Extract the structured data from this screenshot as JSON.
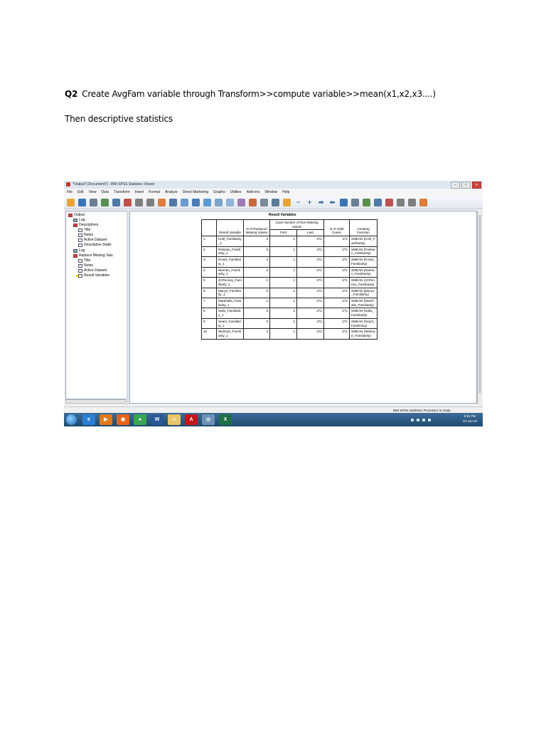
{
  "document": {
    "question_number": "Q2",
    "question_text": "Create AvgFam variable through Transform>>compute variable>>mean(x1,x2,x3....)",
    "subtext": "Then descriptive statistics"
  },
  "window": {
    "title": "*Output7 [Document7] - IBM SPSS Statistics Viewer",
    "controls": {
      "minimize": "–",
      "maximize": "□",
      "close": "✕"
    }
  },
  "menubar": {
    "items": [
      "File",
      "Edit",
      "View",
      "Data",
      "Transform",
      "Insert",
      "Format",
      "Analyze",
      "Direct Marketing",
      "Graphs",
      "Utilities",
      "Add-ons",
      "Window",
      "Help"
    ]
  },
  "toolbar": {
    "icons": [
      "open-icon",
      "save-icon",
      "print-icon",
      "print-preview-icon",
      "export-icon",
      "recall-dialog-icon",
      "undo-icon",
      "redo-icon",
      "goto-case-icon",
      "goto-variable-icon",
      "variables-icon",
      "insert-cases-icon",
      "insert-variable-icon",
      "split-file-icon",
      "select-cases-icon",
      "weight-cases-icon",
      "value-labels-icon",
      "show-all-icon",
      "designate-window-icon",
      "promote-icon",
      "demote-icon",
      "expand-icon",
      "collapse-icon",
      "show-icon",
      "hide-icon",
      "insert-heading-icon",
      "insert-title-icon",
      "insert-text-icon"
    ],
    "prev_symbol": "⬅",
    "next_symbol": "➡",
    "expand_symbol": "+",
    "collapse_symbol": "−"
  },
  "navigator": {
    "items": [
      {
        "label": "Output",
        "icon": "output-book-icon"
      },
      {
        "label": "Log",
        "icon": "log-icon"
      },
      {
        "label": "Descriptives",
        "icon": "descriptives-book-icon"
      },
      {
        "label": "Title",
        "icon": "title-icon"
      },
      {
        "label": "Notes",
        "icon": "notes-icon"
      },
      {
        "label": "Active Dataset",
        "icon": "active-dataset-icon"
      },
      {
        "label": "Descriptive Statis",
        "icon": "descriptive-stats-icon"
      },
      {
        "label": "Log",
        "icon": "log-icon"
      },
      {
        "label": "Replace Missing Valu",
        "icon": "replace-missing-book-icon"
      },
      {
        "label": "Title",
        "icon": "title-icon"
      },
      {
        "label": "Notes",
        "icon": "notes-icon"
      },
      {
        "label": "Active Dataset",
        "icon": "active-dataset-icon"
      },
      {
        "label": "Result Variables",
        "icon": "result-variables-icon"
      }
    ]
  },
  "table": {
    "title": "Result Variables",
    "headers": {
      "result_variable": "Result Variable",
      "n_replaced": "N of Replaced Missing Values",
      "case_number_group": "Case Number of Non-Missing Values",
      "first": "First",
      "last": "Last",
      "n_valid": "N of Valid Cases",
      "creating_function": "Creating Function"
    },
    "rows": [
      {
        "num": "1",
        "var": "Kohl_Familiarity_1",
        "replaced": "3",
        "first": "1",
        "last": "271",
        "valid": "271",
        "func": "SMEAN (Kohl_Familiarity)"
      },
      {
        "num": "2",
        "var": "Parisian_Familiarity_1",
        "replaced": "0",
        "first": "1",
        "last": "271",
        "valid": "271",
        "func": "SMEAN (Parisian_Familiarity)"
      },
      {
        "num": "3",
        "var": "Kmart_Familiarity_1",
        "replaced": "0",
        "first": "1",
        "last": "271",
        "valid": "271",
        "func": "SMEAN (Kmart_Familiarity)"
      },
      {
        "num": "4",
        "var": "Nieman_Familiarity_1",
        "replaced": "0",
        "first": "1",
        "last": "271",
        "valid": "271",
        "func": "SMEAN (Nieman_Familiarity)"
      },
      {
        "num": "5",
        "var": "JCPenney_Familiarity_1",
        "replaced": "1",
        "first": "1",
        "last": "271",
        "valid": "271",
        "func": "SMEAN (JCPenney_Familiarity)"
      },
      {
        "num": "6",
        "var": "Macys_Familiarity_1",
        "replaced": "0",
        "first": "1",
        "last": "271",
        "valid": "271",
        "func": "SMEAN (Macys_Familiarity)"
      },
      {
        "num": "7",
        "var": "Marshalls_Familiarity_1",
        "replaced": "1",
        "first": "1",
        "last": "271",
        "valid": "271",
        "func": "SMEAN (Marshalls_Familiarity)"
      },
      {
        "num": "8",
        "var": "Saks_Familiarity_1",
        "replaced": "0",
        "first": "1",
        "last": "271",
        "valid": "271",
        "func": "SMEAN (Saks_Familiarity)"
      },
      {
        "num": "9",
        "var": "Sears_Familiarity_1",
        "replaced": "0",
        "first": "1",
        "last": "271",
        "valid": "271",
        "func": "SMEAN (Sears_Familiarity)"
      },
      {
        "num": "10",
        "var": "Walmart_Familiarity_1",
        "replaced": "2",
        "first": "1",
        "last": "271",
        "valid": "271",
        "func": "SMEAN (Walmart_Familiarity)"
      }
    ]
  },
  "statusbar": {
    "text": "IBM SPSS Statistics Processor is ready"
  },
  "taskbar": {
    "apps": [
      {
        "name": "ie-icon",
        "glyph": "e",
        "color": "#2a7fd4"
      },
      {
        "name": "media-player-icon",
        "glyph": "▶",
        "color": "#e07b1a"
      },
      {
        "name": "firefox-icon",
        "glyph": "◉",
        "color": "#e8641a"
      },
      {
        "name": "chrome-icon",
        "glyph": "●",
        "color": "#3aa655"
      },
      {
        "name": "word-icon",
        "glyph": "W",
        "color": "#2b5797"
      },
      {
        "name": "folder-icon",
        "glyph": "▭",
        "color": "#e9c46a"
      },
      {
        "name": "acrobat-icon",
        "glyph": "A",
        "color": "#c4161c"
      },
      {
        "name": "spss-icon",
        "glyph": "◎",
        "color": "#6b8fb5"
      },
      {
        "name": "excel-icon",
        "glyph": "X",
        "color": "#1e7145"
      }
    ],
    "clock_time": "6:51 PM",
    "clock_date": "04-Jun-20"
  },
  "colors": {
    "title_bar": "#dfe7f2",
    "taskbar": "#2c5a82",
    "selection_marker": "#f7d200"
  }
}
